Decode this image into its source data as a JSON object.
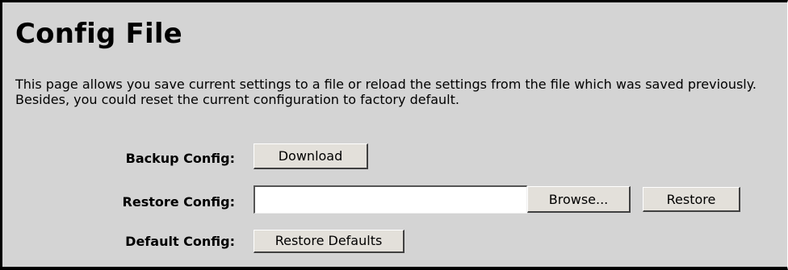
{
  "page": {
    "title": "Config File",
    "description": "This page allows you save current settings to a file or reload the settings from the file which was saved previously. Besides, you could reset the current configuration to factory default."
  },
  "backup": {
    "label": "Backup Config:",
    "button_label": "Download"
  },
  "restore": {
    "label": "Restore Config:",
    "file_value": "",
    "browse_label": "Browse...",
    "button_label": "Restore"
  },
  "defaults": {
    "label": "Default Config:",
    "button_label": "Restore Defaults"
  }
}
